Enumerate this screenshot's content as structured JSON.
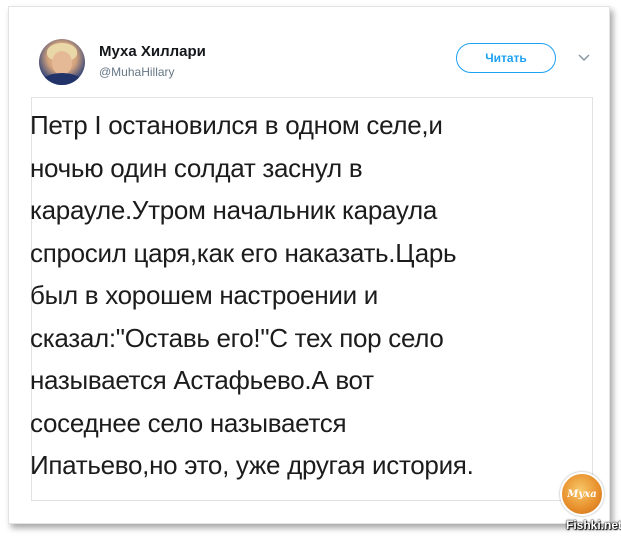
{
  "tweet": {
    "author_name": "Муха Хиллари",
    "author_handle": "@MuhaHillary",
    "follow_label": "Читать",
    "text_lines": [
      "Петр I остановился в одном селе,и",
      "ночью один солдат заснул в",
      "карауле.Утром начальник караула",
      "спросил царя,как его наказать.Царь",
      "был в хорошем настроении и",
      "сказал:\"Оставь его!\"С тех пор село",
      "называется Астафьево.А вот",
      "соседнее село называется",
      "Ипатьево,но это, уже другая история."
    ]
  },
  "watermark": {
    "logo_text": "Муха",
    "site": "Fishki.net"
  },
  "colors": {
    "accent": "#1da1f2",
    "text": "#1c1c1c",
    "muted": "#657786"
  },
  "icons": {
    "chevron": "chevron-down-icon",
    "avatar": "avatar"
  }
}
